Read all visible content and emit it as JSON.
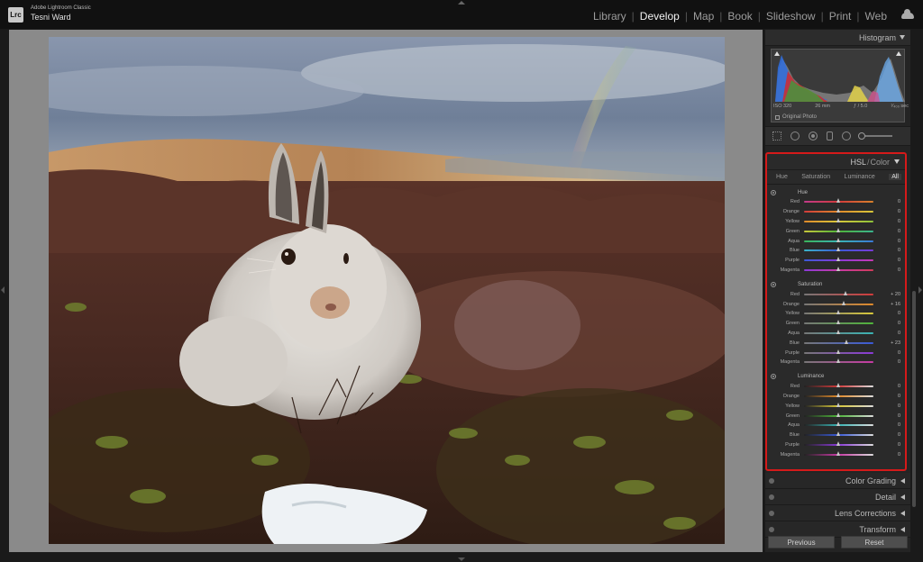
{
  "app": {
    "logo_text": "Lrc",
    "name": "Adobe Lightroom Classic",
    "user": "Tesni Ward"
  },
  "modules": [
    {
      "label": "Library",
      "active": false
    },
    {
      "label": "Develop",
      "active": true
    },
    {
      "label": "Map",
      "active": false
    },
    {
      "label": "Book",
      "active": false
    },
    {
      "label": "Slideshow",
      "active": false
    },
    {
      "label": "Print",
      "active": false
    },
    {
      "label": "Web",
      "active": false
    }
  ],
  "histogram": {
    "title": "Histogram",
    "iso": "ISO 320",
    "focal": "26 mm",
    "aperture": "ƒ / 5.0",
    "shutter": "¹⁄₄₀₀ sec",
    "original_photo": "Original Photo"
  },
  "hsl": {
    "title_a": "HSL",
    "title_sep": "/",
    "title_b": "Color",
    "tabs": [
      "Hue",
      "Saturation",
      "Luminance",
      "All"
    ],
    "active_tab": "All",
    "sections": [
      {
        "title": "Hue",
        "sliders": [
          {
            "label": "Red",
            "value": "0",
            "pos": 0.5
          },
          {
            "label": "Orange",
            "value": "0",
            "pos": 0.5
          },
          {
            "label": "Yellow",
            "value": "0",
            "pos": 0.5
          },
          {
            "label": "Green",
            "value": "0",
            "pos": 0.5
          },
          {
            "label": "Aqua",
            "value": "0",
            "pos": 0.5
          },
          {
            "label": "Blue",
            "value": "0",
            "pos": 0.5
          },
          {
            "label": "Purple",
            "value": "0",
            "pos": 0.5
          },
          {
            "label": "Magenta",
            "value": "0",
            "pos": 0.5
          }
        ]
      },
      {
        "title": "Saturation",
        "sliders": [
          {
            "label": "Red",
            "value": "+ 20",
            "pos": 0.6
          },
          {
            "label": "Orange",
            "value": "+ 16",
            "pos": 0.58
          },
          {
            "label": "Yellow",
            "value": "0",
            "pos": 0.5
          },
          {
            "label": "Green",
            "value": "0",
            "pos": 0.5
          },
          {
            "label": "Aqua",
            "value": "0",
            "pos": 0.5
          },
          {
            "label": "Blue",
            "value": "+ 23",
            "pos": 0.615
          },
          {
            "label": "Purple",
            "value": "0",
            "pos": 0.5
          },
          {
            "label": "Magenta",
            "value": "0",
            "pos": 0.5
          }
        ]
      },
      {
        "title": "Luminance",
        "sliders": [
          {
            "label": "Red",
            "value": "0",
            "pos": 0.5
          },
          {
            "label": "Orange",
            "value": "0",
            "pos": 0.5
          },
          {
            "label": "Yellow",
            "value": "0",
            "pos": 0.5
          },
          {
            "label": "Green",
            "value": "0",
            "pos": 0.5
          },
          {
            "label": "Aqua",
            "value": "0",
            "pos": 0.5
          },
          {
            "label": "Blue",
            "value": "0",
            "pos": 0.5
          },
          {
            "label": "Purple",
            "value": "0",
            "pos": 0.5
          },
          {
            "label": "Magenta",
            "value": "0",
            "pos": 0.5
          }
        ]
      }
    ]
  },
  "collapsed_panels": [
    "Color Grading",
    "Detail",
    "Lens Corrections",
    "Transform"
  ],
  "buttons": {
    "previous": "Previous",
    "reset": "Reset"
  },
  "colors": {
    "highlight": "#d51a1a",
    "active_module": "#f2f2f2"
  }
}
